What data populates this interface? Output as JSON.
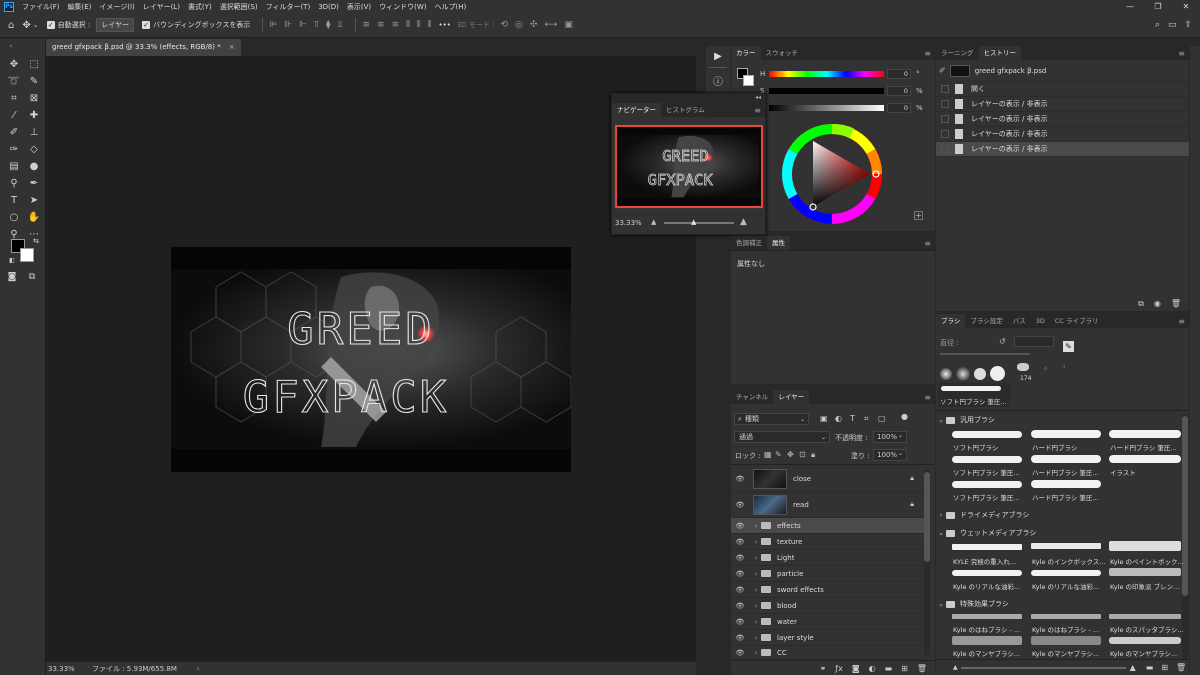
{
  "app": {
    "logo": "Ps"
  },
  "menubar": {
    "items": [
      "ファイル(F)",
      "編集(E)",
      "イメージ(I)",
      "レイヤー(L)",
      "書式(Y)",
      "選択範囲(S)",
      "フィルター(T)",
      "3D(D)",
      "表示(V)",
      "ウィンドウ(W)",
      "ヘルプ(H)"
    ],
    "minimize": "—",
    "maximize": "❐",
    "close": "✕"
  },
  "options": {
    "auto_select_label": "自動選択 :",
    "auto_select_value": "レイヤー",
    "bounding_box_label": "バウンディングボックスを表示",
    "more": "•••",
    "mode_3d_label": "3D モード :"
  },
  "document": {
    "tab_title": "greed gfxpack β.psd @ 33.3% (effects, RGB/8) *",
    "close": "×",
    "art_text_line1": "GREED",
    "art_text_line2": "GFXPACK"
  },
  "status": {
    "zoom": "33.33%",
    "file_info": "ファイル : 5.93M/655.8M",
    "arrow": "›"
  },
  "color_panel": {
    "tabs": [
      "カラー",
      "スウォッチ"
    ],
    "h_label": "H",
    "s_label": "S",
    "b_label": "B",
    "h_value": "0",
    "s_value": "0",
    "b_value": "0",
    "h_unit": "°",
    "s_unit": "%",
    "b_unit": "%",
    "add": "+"
  },
  "navigator": {
    "tabs": [
      "ナビゲーター",
      "ヒストグラム"
    ],
    "zoom": "33.33%"
  },
  "adjust_panel": {
    "tabs": [
      "色調補正",
      "属性"
    ],
    "content": "属性なし"
  },
  "history": {
    "tabs": [
      "ラーニング",
      "ヒストリー"
    ],
    "snapshot": "greed gfxpack β.psd",
    "items": [
      "開く",
      "レイヤーの表示 / 非表示",
      "レイヤーの表示 / 非表示",
      "レイヤーの表示 / 非表示",
      "レイヤーの表示 / 非表示"
    ]
  },
  "brush_panel": {
    "tabs": [
      "ブラシ",
      "ブラシ設定",
      "パス",
      "3D",
      "CC ライブラリ"
    ],
    "size_label": "直径 :",
    "preset_size": "174",
    "current_brush": "ソフト円ブラシ 筆圧...",
    "groups": [
      {
        "name": "汎用ブラシ",
        "items": [
          "ソフト円ブラシ",
          "ハード円ブラシ",
          "ハード円ブラシ 筆圧...",
          "ソフト円ブラシ 筆圧...",
          "ハード円ブラシ 筆圧...",
          "イラスト",
          "ソフト円ブラシ 筆圧...",
          "ハード円ブラシ 筆圧..."
        ]
      },
      {
        "name": "ドライメディアブラシ"
      },
      {
        "name": "ウェットメディアブラシ",
        "items": [
          "KYLE 究極の重入れ...",
          "Kyle のインクボックス...",
          "Kyle のペイントボック...",
          "Kyle のリアルな油彩...",
          "Kyle のリアルな油彩...",
          "Kyle の印象派 ブレン..."
        ]
      },
      {
        "name": "特殊効果ブラシ",
        "items": [
          "Kyle のはねブラシ - ...",
          "Kyle のはねブラシ - ...",
          "Kyle のスパッタブラシ...",
          "Kyle のマンヤブラシ...",
          "Kyle のマンヤブラシ...",
          "Kyle のマンヤブラシ..."
        ]
      }
    ]
  },
  "layers_panel": {
    "tabs": [
      "チャンネル",
      "レイヤー"
    ],
    "filter_kind": "種類",
    "blend_mode": "通過",
    "opacity_label": "不透明度 :",
    "opacity_value": "100%",
    "lock_label": "ロック :",
    "fill_label": "塗り :",
    "fill_value": "100%",
    "layers": [
      {
        "name": "close",
        "type": "image",
        "locked": true
      },
      {
        "name": "read",
        "type": "image",
        "locked": true
      },
      {
        "name": "effects",
        "type": "group",
        "selected": true
      },
      {
        "name": "texture",
        "type": "group"
      },
      {
        "name": "Light",
        "type": "group"
      },
      {
        "name": "particle",
        "type": "group"
      },
      {
        "name": "sword effects",
        "type": "group"
      },
      {
        "name": "blood",
        "type": "group"
      },
      {
        "name": "water",
        "type": "group"
      },
      {
        "name": "layer style",
        "type": "group"
      },
      {
        "name": "CC",
        "type": "group"
      }
    ]
  },
  "colors": {
    "accent": "#31a8ff",
    "panel": "#323232",
    "canvas_bg": "#1f1f1f",
    "highlight_red": "#e8453c"
  }
}
